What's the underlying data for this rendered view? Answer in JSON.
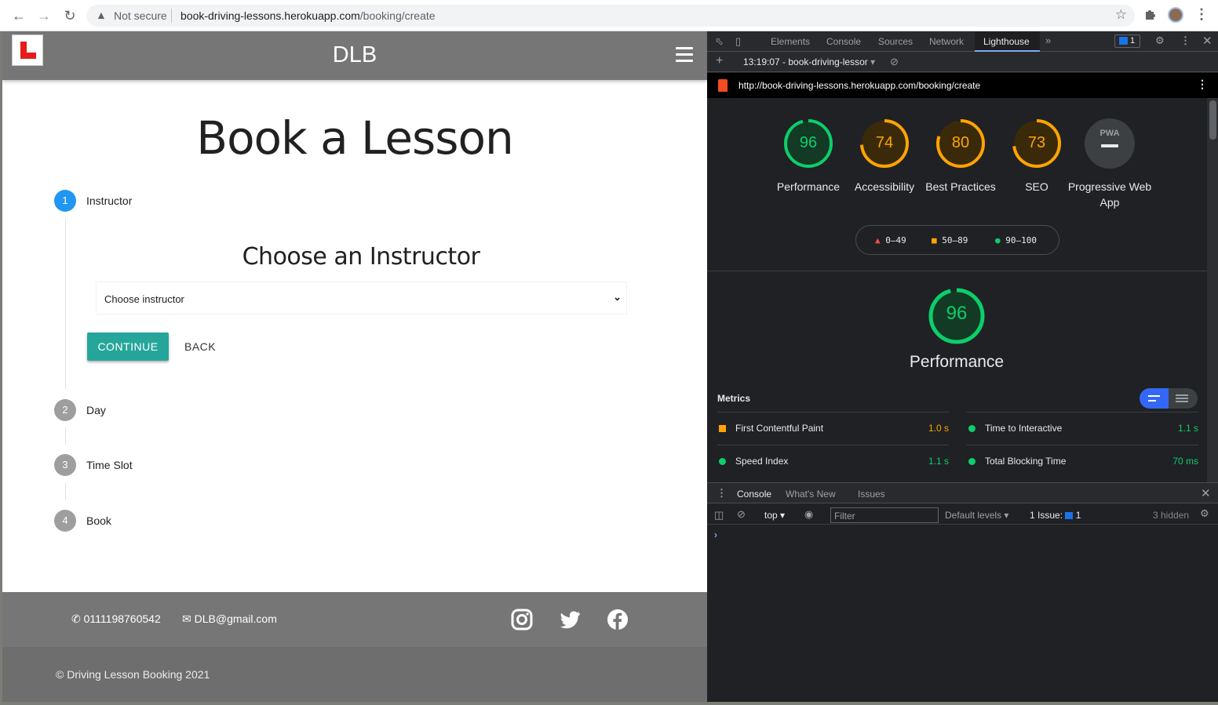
{
  "browser": {
    "security": "Not secure",
    "url_host": "book-driving-lessons.herokuapp.com",
    "url_path": "/booking/create"
  },
  "site": {
    "brand": "DLB",
    "page_title": "Book a Lesson",
    "steps": [
      {
        "number": "1",
        "label": "Instructor"
      },
      {
        "number": "2",
        "label": "Day"
      },
      {
        "number": "3",
        "label": "Time Slot"
      },
      {
        "number": "4",
        "label": "Book"
      }
    ],
    "step_heading": "Choose an Instructor",
    "select_value": "Choose instructor",
    "continue_label": "CONTINUE",
    "back_label": "BACK",
    "footer": {
      "phone": "0111198760542",
      "email": "DLB@gmail.com",
      "copyright": "© Driving Lesson Booking 2021"
    }
  },
  "devtools": {
    "tabs": [
      "Elements",
      "Console",
      "Sources",
      "Network",
      "Lighthouse"
    ],
    "active_tab": "Lighthouse",
    "issues_count": "1",
    "report_select": "13:19:07 - book-driving-lessor",
    "report_url": "http://book-driving-lessons.herokuapp.com/booking/create",
    "scores": [
      {
        "score": "96",
        "label": "Performance",
        "value": 0.96,
        "color": "#0cce6b"
      },
      {
        "score": "74",
        "label": "Accessibility",
        "value": 0.74,
        "color": "#ffa400"
      },
      {
        "score": "80",
        "label": "Best Practices",
        "value": 0.8,
        "color": "#ffa400"
      },
      {
        "score": "73",
        "label": "SEO",
        "value": 0.73,
        "color": "#ffa400"
      }
    ],
    "pwa": {
      "badge": "PWA",
      "label": "Progressive Web App"
    },
    "legend": [
      {
        "range": "0–49",
        "color": "#ff4e42"
      },
      {
        "range": "50–89",
        "color": "#ffa400"
      },
      {
        "range": "90–100",
        "color": "#0cce6b"
      }
    ],
    "performance": {
      "score": "96",
      "title": "Performance",
      "value": 0.96
    },
    "metrics_title": "Metrics",
    "metrics": [
      {
        "name": "First Contentful Paint",
        "value": "1.0 s",
        "status": "average"
      },
      {
        "name": "Time to Interactive",
        "value": "1.1 s",
        "status": "pass"
      },
      {
        "name": "Speed Index",
        "value": "1.1 s",
        "status": "pass"
      },
      {
        "name": "Total Blocking Time",
        "value": "70 ms",
        "status": "pass"
      }
    ],
    "drawer": {
      "tabs": [
        "Console",
        "What's New",
        "Issues"
      ],
      "context": "top",
      "filter_placeholder": "Filter",
      "levels": "Default levels",
      "issues_label": "1 Issue:",
      "issues_count": "1",
      "hidden": "3 hidden"
    }
  }
}
